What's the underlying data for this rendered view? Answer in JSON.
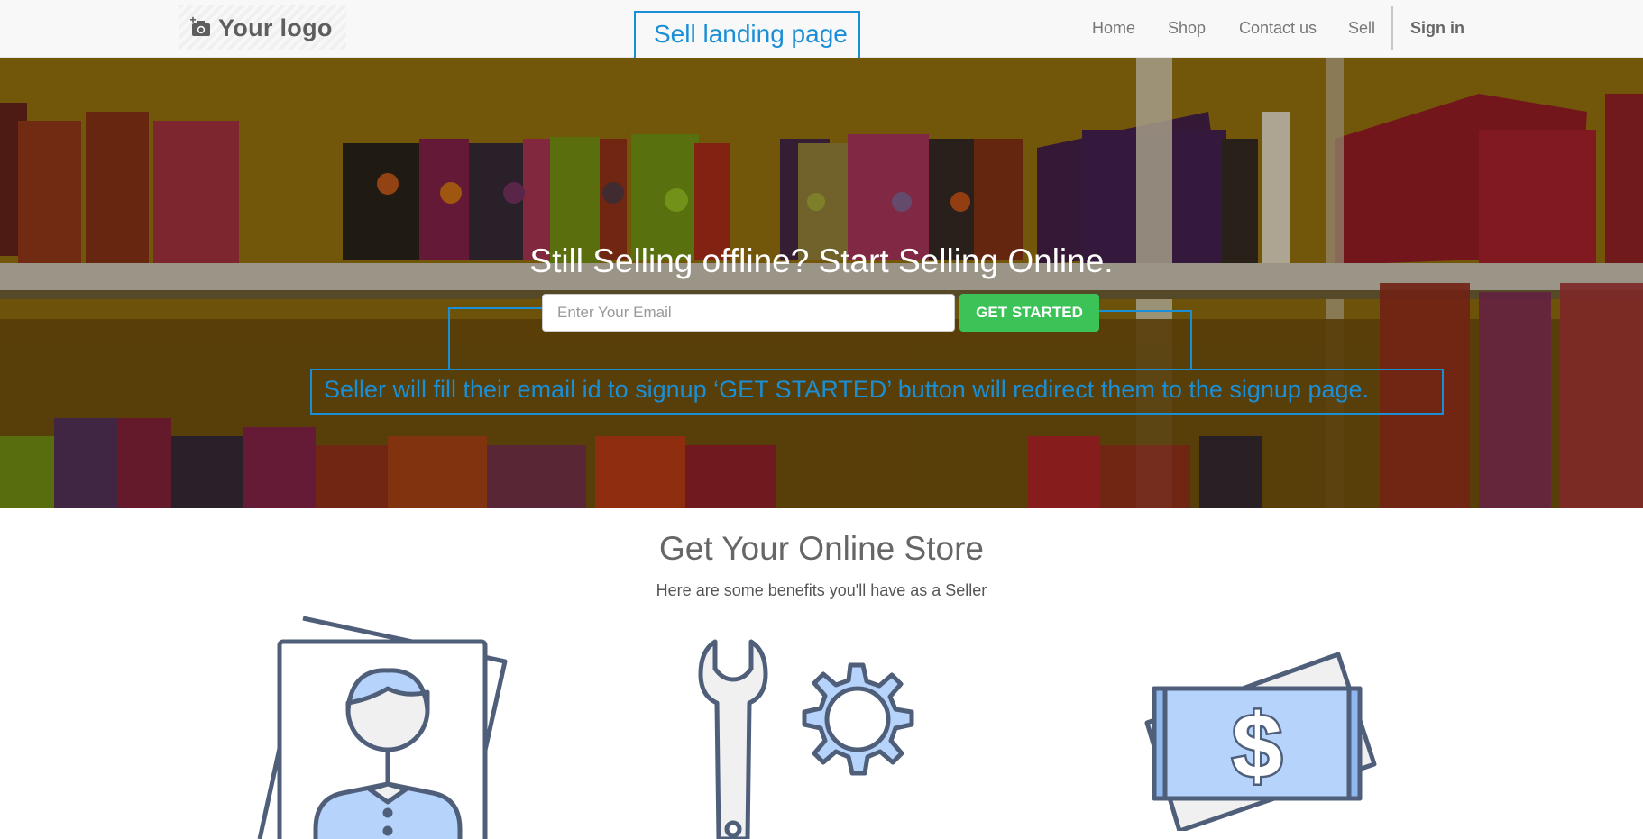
{
  "header": {
    "logo_text": "Your logo",
    "nav": [
      {
        "label": "Home"
      },
      {
        "label": "Shop"
      },
      {
        "label": "Contact us"
      },
      {
        "label": "Sell"
      },
      {
        "label": "Sign in"
      }
    ]
  },
  "annotations": {
    "page_label": "Sell landing page",
    "signup_note": "Seller will fill their email id to signup ‘GET STARTED’ button will redirect them to the signup page."
  },
  "hero": {
    "title": "Still Selling offline? Start Selling Online.",
    "email_placeholder": "Enter Your Email",
    "email_value": "",
    "cta_label": "GET STARTED"
  },
  "benefits": {
    "title": "Get Your Online Store",
    "subtitle": "Here are some benefits you'll have as a Seller",
    "icons": [
      "seller-profile-icon",
      "wrench-gear-icon",
      "money-icon"
    ]
  },
  "colors": {
    "annotation": "#1a8fd6",
    "cta": "#3cc358",
    "icon_fill": "#b5d3fb",
    "icon_stroke": "#4f5f7a"
  }
}
